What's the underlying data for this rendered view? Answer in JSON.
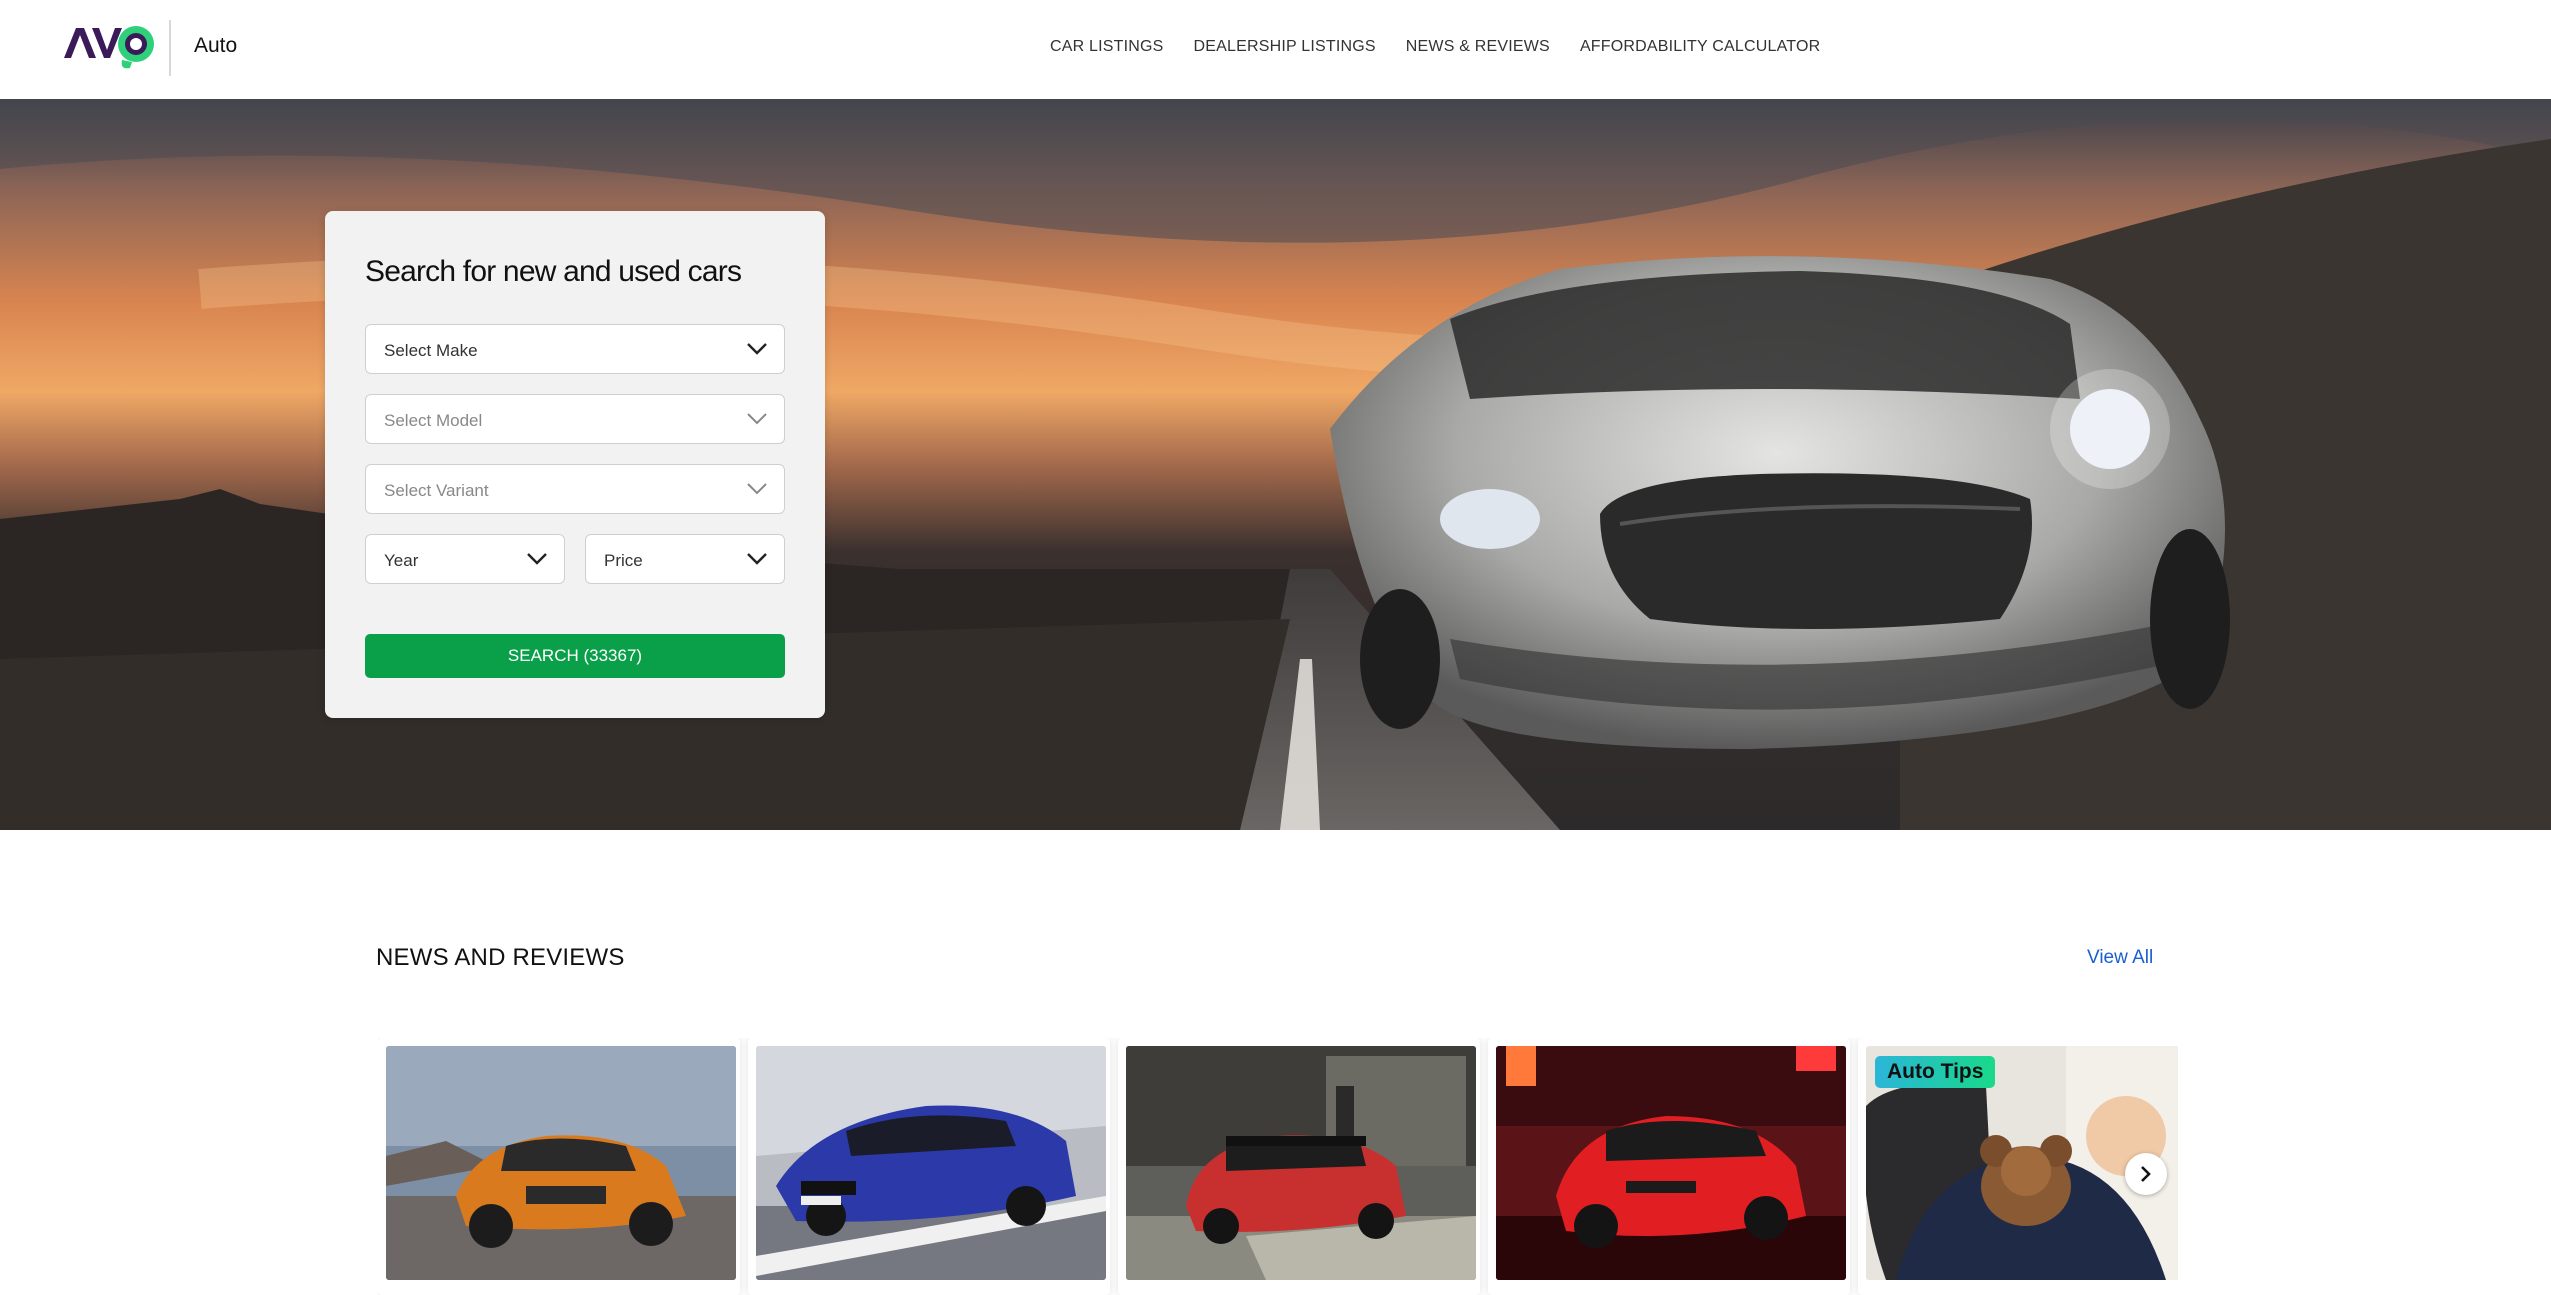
{
  "header": {
    "logo_text": "AVO",
    "logo_sub": "Auto",
    "nav": [
      {
        "label": "CAR LISTINGS"
      },
      {
        "label": "DEALERSHIP LISTINGS"
      },
      {
        "label": "NEWS & REVIEWS"
      },
      {
        "label": "AFFORDABILITY CALCULATOR"
      }
    ]
  },
  "search": {
    "title": "Search for new and used cars",
    "make": "Select Make",
    "model": "Select Model",
    "variant": "Select Variant",
    "year": "Year",
    "price": "Price",
    "button": "SEARCH (33367)"
  },
  "news": {
    "title": "NEWS AND REVIEWS",
    "view_all": "View All",
    "cards": [
      {
        "image": "orange-suv-photo"
      },
      {
        "image": "blue-coupe-photo"
      },
      {
        "image": "red-mini-photo"
      },
      {
        "image": "red-hatchback-photo"
      },
      {
        "image": "child-in-car-photo",
        "badge": "Auto Tips"
      }
    ]
  },
  "colors": {
    "accent_green": "#0aa04a",
    "link_blue": "#1a5fd0",
    "logo_purple": "#3b1a5a",
    "logo_green": "#2fd07a"
  },
  "icons": {
    "chevron": "chevron-down-icon",
    "next": "chevron-right-icon"
  }
}
